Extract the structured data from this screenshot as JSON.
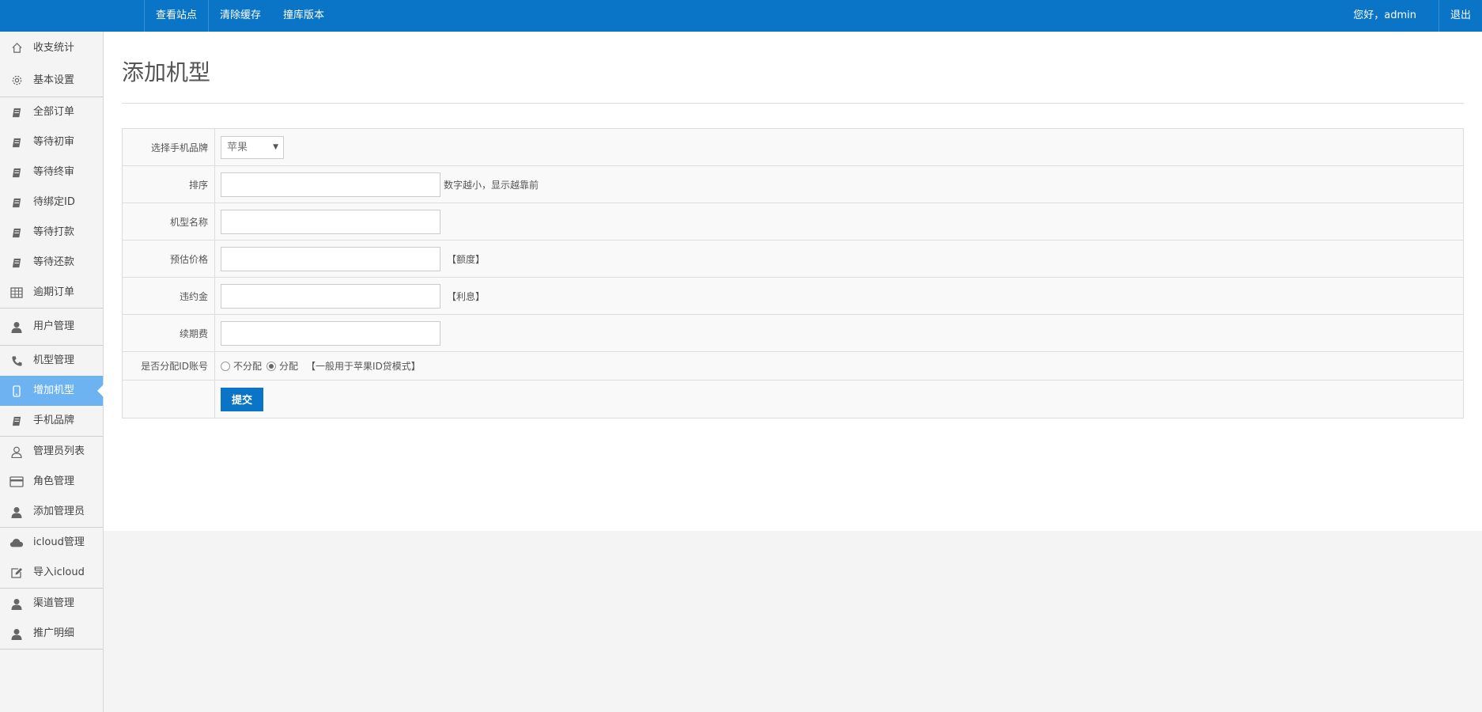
{
  "topbar": {
    "nav": [
      "查看站点",
      "清除缓存",
      "撞库版本"
    ],
    "greeting": "您好，admin",
    "logout": "退出"
  },
  "sidebar": {
    "groups": [
      [
        {
          "label": "收支统计",
          "icon": "home-icon"
        },
        {
          "label": "基本设置",
          "icon": "gear-icon"
        }
      ],
      [
        {
          "label": "全部订单",
          "icon": "book-icon"
        },
        {
          "label": "等待初审",
          "icon": "book-icon"
        },
        {
          "label": "等待终审",
          "icon": "book-icon"
        },
        {
          "label": "待绑定ID",
          "icon": "book-icon"
        },
        {
          "label": "等待打款",
          "icon": "book-icon"
        },
        {
          "label": "等待还款",
          "icon": "book-icon"
        },
        {
          "label": "逾期订单",
          "icon": "table-icon"
        }
      ],
      [
        {
          "label": "用户管理",
          "icon": "user-icon"
        }
      ],
      [
        {
          "label": "机型管理",
          "icon": "phone-icon"
        },
        {
          "label": "增加机型",
          "icon": "mobile-icon",
          "active": true
        },
        {
          "label": "手机品牌",
          "icon": "book-icon"
        }
      ],
      [
        {
          "label": "管理员列表",
          "icon": "user-outline-icon"
        },
        {
          "label": "角色管理",
          "icon": "card-icon"
        },
        {
          "label": "添加管理员",
          "icon": "user-icon"
        }
      ],
      [
        {
          "label": "icloud管理",
          "icon": "cloud-icon"
        },
        {
          "label": "导入icloud",
          "icon": "edit-icon"
        }
      ],
      [
        {
          "label": "渠道管理",
          "icon": "user-icon"
        },
        {
          "label": "推广明细",
          "icon": "user-icon"
        }
      ]
    ]
  },
  "page": {
    "title": "添加机型",
    "form": {
      "brand_label": "选择手机品牌",
      "brand_value": "苹果",
      "sort_label": "排序",
      "sort_value": "",
      "sort_hint": "数字越小，显示越靠前",
      "name_label": "机型名称",
      "name_value": "",
      "price_label": "预估价格",
      "price_value": "",
      "price_hint": "【额度】",
      "penalty_label": "违约金",
      "penalty_value": "",
      "penalty_hint": "【利息】",
      "renew_label": "续期费",
      "renew_value": "",
      "assign_label": "是否分配ID账号",
      "assign_options": [
        "不分配",
        "分配"
      ],
      "assign_selected": "分配",
      "assign_hint": "【一般用于苹果ID贷模式】",
      "submit_label": "提交"
    }
  },
  "colors": {
    "topbar": "#0a74c6",
    "active_sidebar": "#6db3f2",
    "submit": "#0a74c6"
  }
}
